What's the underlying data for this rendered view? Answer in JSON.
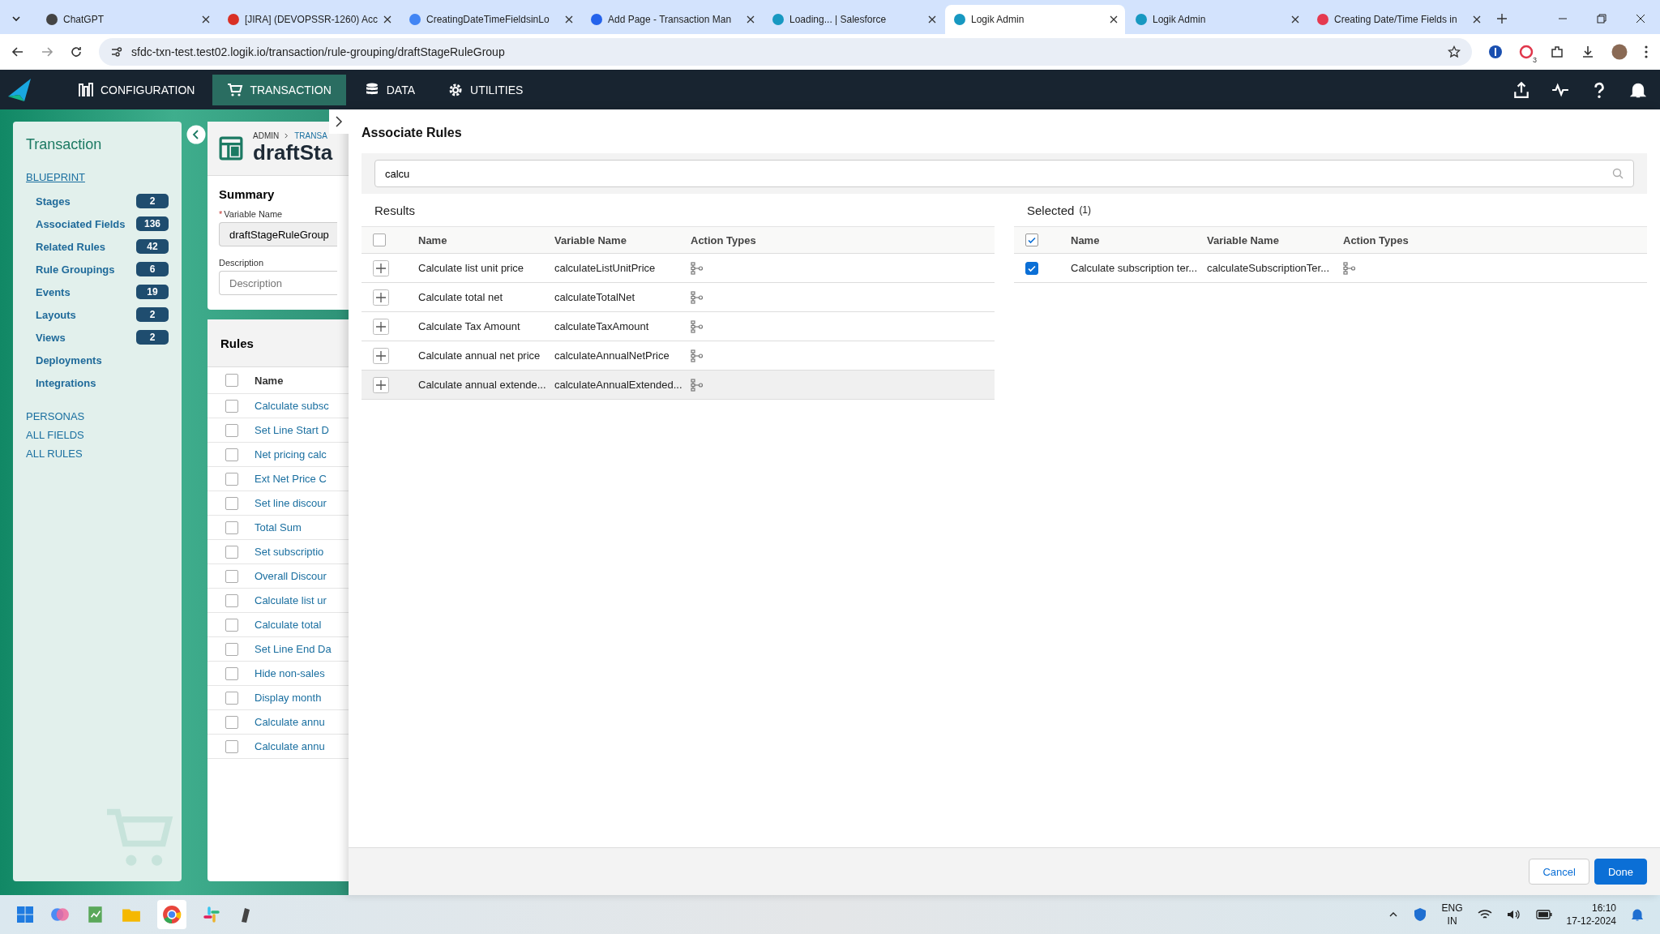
{
  "browser": {
    "tabs": [
      {
        "title": "ChatGPT",
        "selected": false
      },
      {
        "title": "[JIRA] (DEVOPSSR-1260) Acc",
        "selected": false
      },
      {
        "title": "CreatingDateTimeFieldsinLo",
        "selected": false
      },
      {
        "title": "Add Page - Transaction Man",
        "selected": false
      },
      {
        "title": "Loading... | Salesforce",
        "selected": false
      },
      {
        "title": "Logik Admin",
        "selected": true
      },
      {
        "title": "Logik Admin",
        "selected": false
      },
      {
        "title": "Creating Date/Time Fields in",
        "selected": false
      }
    ],
    "url": "sfdc-txn-test.test02.logik.io/transaction/rule-grouping/draftStageRuleGroup",
    "extension_badge": "3"
  },
  "nav": {
    "items": [
      {
        "label": "CONFIGURATION",
        "selected": false
      },
      {
        "label": "TRANSACTION",
        "selected": true
      },
      {
        "label": "DATA",
        "selected": false
      },
      {
        "label": "UTILITIES",
        "selected": false
      }
    ]
  },
  "sidebar": {
    "title": "Transaction",
    "section": "BLUEPRINT",
    "items": [
      {
        "label": "Stages",
        "count": "2"
      },
      {
        "label": "Associated Fields",
        "count": "136"
      },
      {
        "label": "Related Rules",
        "count": "42"
      },
      {
        "label": "Rule Groupings",
        "count": "6"
      },
      {
        "label": "Events",
        "count": "19"
      },
      {
        "label": "Layouts",
        "count": "2"
      },
      {
        "label": "Views",
        "count": "2"
      },
      {
        "label": "Deployments"
      },
      {
        "label": "Integrations"
      }
    ],
    "links": [
      "PERSONAS",
      "ALL FIELDS",
      "ALL RULES"
    ]
  },
  "record": {
    "breadcrumb": [
      "ADMIN",
      "TRANSA"
    ],
    "title": "draftSta",
    "summary": {
      "heading": "Summary",
      "required_mark": "*",
      "variable_label": "Variable Name",
      "variable_value": "draftStageRuleGroup",
      "description_label": "Description",
      "description_placeholder": "Description"
    },
    "rules": {
      "heading": "Rules",
      "all_checked": false,
      "column": "Name",
      "rows": [
        {
          "name": "Calculate subsc",
          "checked": false
        },
        {
          "name": "Set Line Start D",
          "checked": false
        },
        {
          "name": "Net pricing calc",
          "checked": false
        },
        {
          "name": "Ext Net Price C",
          "checked": false
        },
        {
          "name": "Set line discour",
          "checked": false
        },
        {
          "name": "Total Sum",
          "checked": false
        },
        {
          "name": "Set subscriptio",
          "checked": false
        },
        {
          "name": "Overall Discour",
          "checked": false
        },
        {
          "name": "Calculate list ur",
          "checked": false
        },
        {
          "name": "Calculate total",
          "checked": false
        },
        {
          "name": "Set Line End Da",
          "checked": false
        },
        {
          "name": "Hide non-sales",
          "checked": false
        },
        {
          "name": "Display month",
          "checked": false
        },
        {
          "name": "Calculate annu",
          "checked": false
        },
        {
          "name": "Calculate annu",
          "checked": false
        }
      ]
    }
  },
  "dialog": {
    "title": "Associate Rules",
    "search": {
      "value": "calcu"
    },
    "results": {
      "heading": "Results",
      "all_checked": false,
      "columns": [
        "Name",
        "Variable Name",
        "Action Types"
      ],
      "rows": [
        {
          "name": "Calculate list unit price",
          "variable": "calculateListUnitPrice",
          "highlighted": false
        },
        {
          "name": "Calculate total net",
          "variable": "calculateTotalNet",
          "highlighted": false
        },
        {
          "name": "Calculate Tax Amount",
          "variable": "calculateTaxAmount",
          "highlighted": false
        },
        {
          "name": "Calculate annual net price",
          "variable": "calculateAnnualNetPrice",
          "highlighted": false
        },
        {
          "name": "Calculate annual extende...",
          "variable": "calculateAnnualExtended...",
          "highlighted": true
        }
      ]
    },
    "selected": {
      "heading": "Selected",
      "count": "(1)",
      "all_checked": true,
      "columns": [
        "Name",
        "Variable Name",
        "Action Types"
      ],
      "rows": [
        {
          "name": "Calculate subscription ter...",
          "variable": "calculateSubscriptionTer...",
          "checked": true
        }
      ]
    },
    "buttons": [
      {
        "label": "Cancel",
        "kind": "secondary"
      },
      {
        "label": "Done",
        "kind": "primary"
      }
    ]
  },
  "taskbar": {
    "language": "ENG",
    "region": "IN",
    "time": "16:10",
    "date": "17-12-2024"
  }
}
